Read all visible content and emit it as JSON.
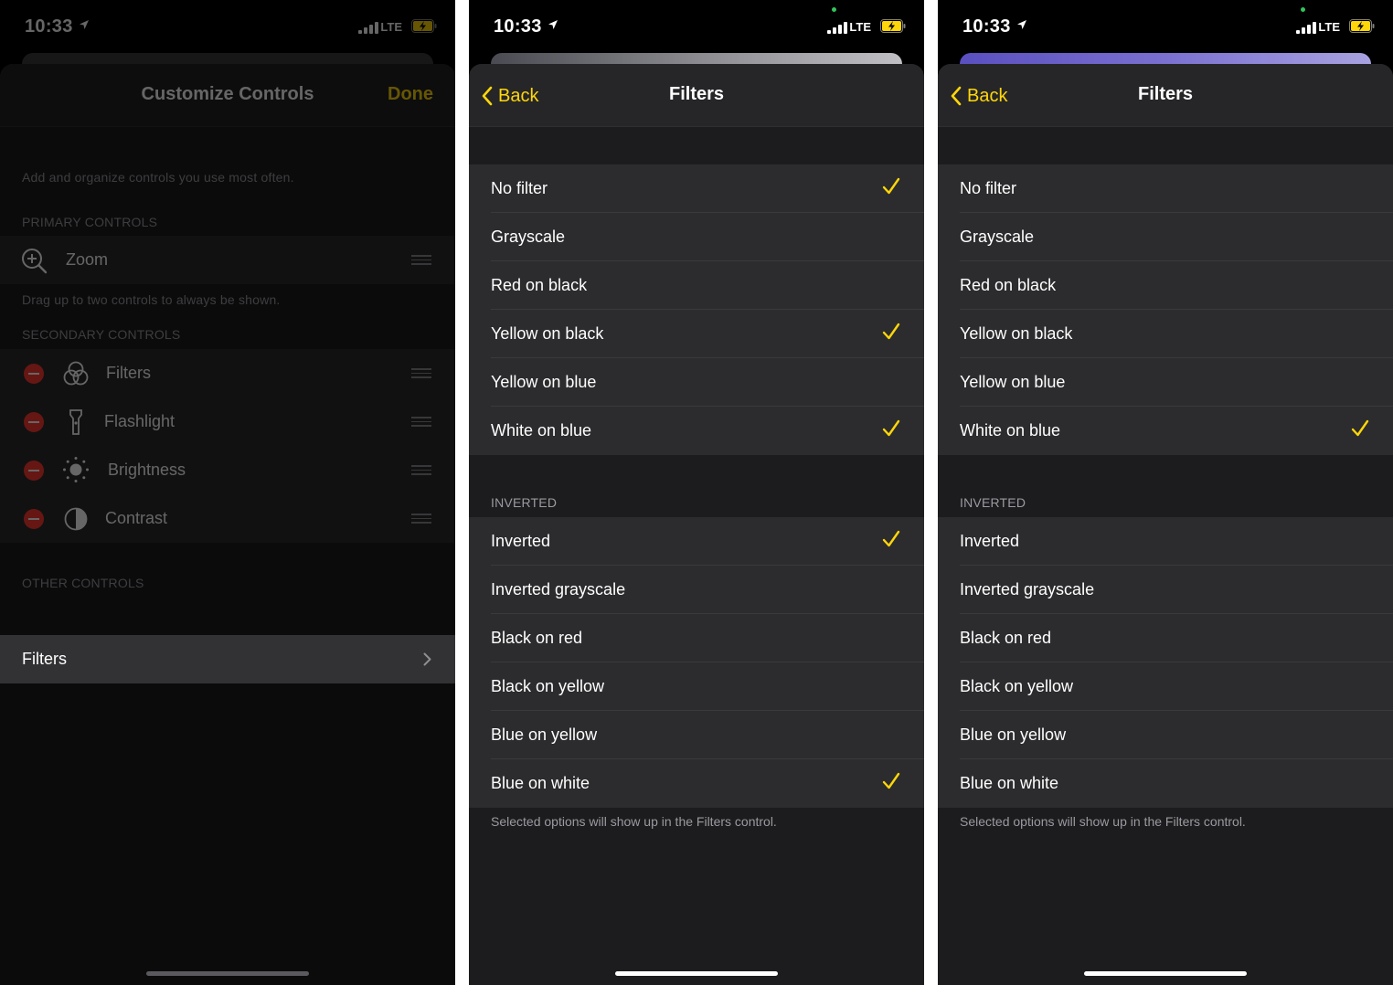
{
  "screens": [
    {
      "status": {
        "time": "10:33",
        "network": "LTE"
      },
      "nav": {
        "title": "Customize Controls",
        "done_label": "Done"
      },
      "intro": "Add and organize controls you use most often.",
      "primary_header": "PRIMARY CONTROLS",
      "primary_items": [
        {
          "label": "Zoom",
          "icon": "zoom-icon"
        }
      ],
      "primary_footer": "Drag up to two controls to always be shown.",
      "secondary_header": "SECONDARY CONTROLS",
      "secondary_items": [
        {
          "label": "Filters",
          "icon": "filters-icon"
        },
        {
          "label": "Flashlight",
          "icon": "flashlight-icon"
        },
        {
          "label": "Brightness",
          "icon": "brightness-icon"
        },
        {
          "label": "Contrast",
          "icon": "contrast-icon"
        }
      ],
      "other_header": "OTHER CONTROLS",
      "highlighted_row": {
        "label": "Filters",
        "icon": "chevron-right-icon"
      }
    },
    {
      "status": {
        "time": "10:33",
        "network": "LTE"
      },
      "nav": {
        "back_label": "Back",
        "title": "Filters"
      },
      "filters": [
        {
          "label": "No filter",
          "checked": true
        },
        {
          "label": "Grayscale",
          "checked": false
        },
        {
          "label": "Red on black",
          "checked": false
        },
        {
          "label": "Yellow on black",
          "checked": true
        },
        {
          "label": "Yellow on blue",
          "checked": false
        },
        {
          "label": "White on blue",
          "checked": true
        }
      ],
      "inverted_header": "INVERTED",
      "inverted": [
        {
          "label": "Inverted",
          "checked": true
        },
        {
          "label": "Inverted grayscale",
          "checked": false
        },
        {
          "label": "Black on red",
          "checked": false
        },
        {
          "label": "Black on yellow",
          "checked": false
        },
        {
          "label": "Blue on yellow",
          "checked": false
        },
        {
          "label": "Blue on white",
          "checked": true
        }
      ],
      "footer": "Selected options will show up in the Filters control."
    },
    {
      "status": {
        "time": "10:33",
        "network": "LTE"
      },
      "nav": {
        "back_label": "Back",
        "title": "Filters"
      },
      "filters": [
        {
          "label": "No filter",
          "checked": false
        },
        {
          "label": "Grayscale",
          "checked": false
        },
        {
          "label": "Red on black",
          "checked": false
        },
        {
          "label": "Yellow on black",
          "checked": false
        },
        {
          "label": "Yellow on blue",
          "checked": false
        },
        {
          "label": "White on blue",
          "checked": true
        }
      ],
      "inverted_header": "INVERTED",
      "inverted": [
        {
          "label": "Inverted",
          "checked": false
        },
        {
          "label": "Inverted grayscale",
          "checked": false
        },
        {
          "label": "Black on red",
          "checked": false
        },
        {
          "label": "Black on yellow",
          "checked": false
        },
        {
          "label": "Blue on yellow",
          "checked": false
        },
        {
          "label": "Blue on white",
          "checked": false
        }
      ],
      "footer": "Selected options will show up in the Filters control."
    }
  ],
  "colors": {
    "accent": "#ffd60a",
    "destructive": "#ff3b30",
    "cell": "#2c2c2e",
    "background": "#1c1c1e"
  }
}
